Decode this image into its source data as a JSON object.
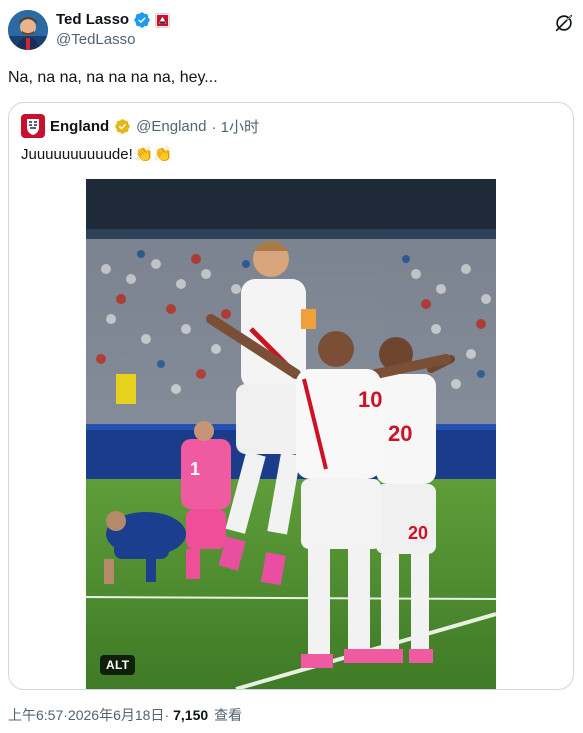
{
  "author": {
    "display_name": "Ted Lasso",
    "handle": "@TedLasso"
  },
  "tweet": {
    "text": "Na, na na, na na na na, hey..."
  },
  "quoted_tweet": {
    "display_name": "England",
    "handle": "@England",
    "time_ago": "· 1小时",
    "text": "Juuuuuuuuuude!",
    "emoji": "👏👏",
    "media_alt_badge": "ALT"
  },
  "photo_details": {
    "jersey_left": "10",
    "jersey_right": "20",
    "keeper_number": "1"
  },
  "meta": {
    "time": "上午6:57",
    "separator1": " · ",
    "date": "2026年6月18日",
    "separator2": " · ",
    "views": "7,150",
    "views_label": "查看"
  },
  "colors": {
    "verified_blue": "#1d9bf0",
    "verified_gold": "#e2b719",
    "secondary_text": "#536471",
    "border": "#cfd9de",
    "england_red": "#ce1124"
  }
}
